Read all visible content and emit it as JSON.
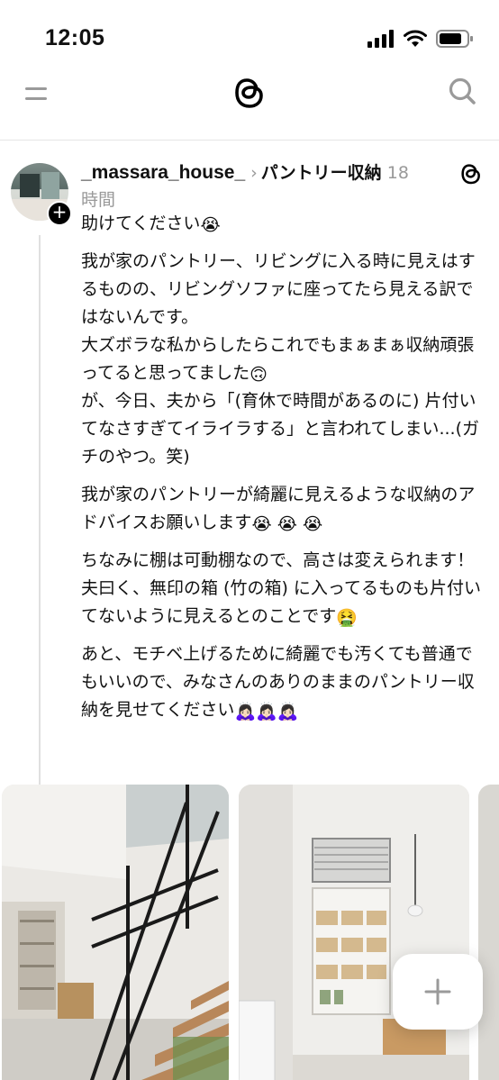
{
  "status_bar": {
    "time": "12:05",
    "icons": [
      "signal-icon",
      "wifi-icon",
      "battery-icon"
    ]
  },
  "header": {
    "menu_icon": "menu-icon",
    "logo": "threads-logo-icon",
    "search_icon": "search-icon"
  },
  "post": {
    "username": "_massara_house_",
    "topic": "パントリー収納",
    "time_prefix": "18",
    "time_suffix": "時間",
    "paragraphs": [
      [
        "助けてください"
      ],
      [
        "我が家のパントリー、リビングに入る時に見えはするものの、リビングソファに座ってたら見える訳ではないんです。",
        "大ズボラな私からしたらこれでもまぁまぁ収納頑張ってると思ってました",
        "が、今日、夫から「(育休で時間があるのに) 片付いてなさすぎてイライラする」と言われてしまい...(ガチのやつ。笑)"
      ],
      [
        "我が家のパントリーが綺麗に見えるような収納のアドバイスお願いします"
      ],
      [
        "ちなみに棚は可動棚なので、高さは変えられます！",
        "夫曰く、無印の箱 (竹の箱) に入ってるものも片付いてないように見えるとのことです"
      ],
      [
        "あと、モチベ上げるために綺麗でも汚くても普通でもいいので、みなさんのありのままのパントリー収納を見せてください"
      ]
    ],
    "emojis": {
      "crying": "😭",
      "upside_down": "🙃",
      "vomiting": "🤮",
      "bowing": "🙇🏻‍♀️"
    }
  },
  "gallery": {
    "photos": [
      "staircase-photo",
      "pantry-photo",
      "partial-photo"
    ]
  },
  "fab": {
    "icon": "plus-icon"
  },
  "colors": {
    "accent": "#000000",
    "muted": "#999999",
    "divider": "#e6e6e6"
  }
}
